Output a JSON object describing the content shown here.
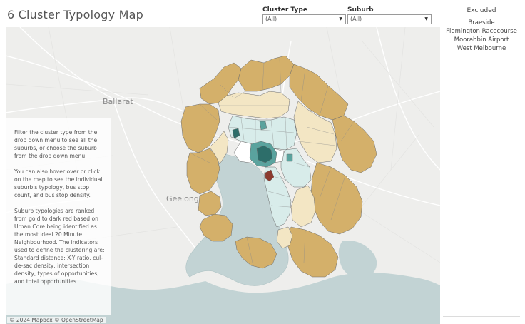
{
  "title": "6 Cluster Typology Map",
  "filters": {
    "cluster_type": {
      "label": "Cluster Type",
      "value": "(All)"
    },
    "suburb": {
      "label": "Suburb",
      "value": "(All)"
    }
  },
  "excluded": {
    "heading": "Excluded",
    "items": [
      "Braeside",
      "Flemington Racecourse",
      "Moorabbin Airport",
      "West Melbourne"
    ]
  },
  "info_box": {
    "paragraphs": [
      "Filter the cluster type from the drop down menu to see all the suburbs, or choose the suburb from the drop down menu.",
      "You can also hover over or click on the map to see the individual suburb's typology, bus stop count, and bus stop density.",
      "Suburb typologies are ranked from gold to dark red based on Urban Core being identified as the most ideal 20 Minute Neighbourhood. The indicators used to define the clustering are: Standard distance; X-Y ratio, cul-de-sac density, intersection density, types of opportunities, and total opportunities."
    ]
  },
  "map": {
    "place_labels": {
      "ballarat": "Ballarat",
      "geelong": "Geelong"
    },
    "attribution": "© 2024 Mapbox © OpenStreetMap",
    "colors": {
      "gold": "#d4b06a",
      "cream": "#f3e6c4",
      "light_teal": "#d8ecea",
      "teal": "#5aa39e",
      "dark_teal": "#2d6e6a",
      "dark_red": "#8c3a2e",
      "water": "#c2d3d4",
      "land": "#eeeeec"
    }
  }
}
